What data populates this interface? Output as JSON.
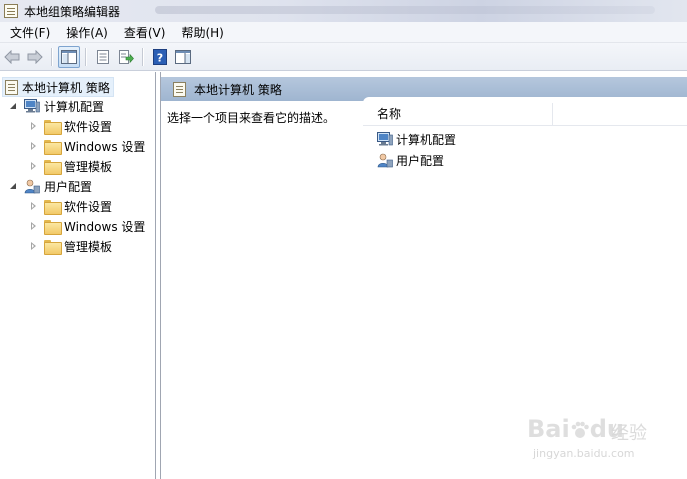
{
  "window": {
    "title": "本地组策略编辑器"
  },
  "menu": [
    {
      "label": "文件(F)"
    },
    {
      "label": "操作(A)"
    },
    {
      "label": "查看(V)"
    },
    {
      "label": "帮助(H)"
    }
  ],
  "toolbar": {
    "icons": [
      "back-arrow-icon",
      "forward-arrow-icon",
      "show-hide-tree-icon",
      "properties-icon",
      "export-list-icon",
      "help-icon",
      "show-action-pane-icon"
    ]
  },
  "tree": {
    "root": "本地计算机 策略",
    "computer_config": "计算机配置",
    "user_config": "用户配置",
    "computer_children": [
      "软件设置",
      "Windows 设置",
      "管理模板"
    ],
    "user_children": [
      "软件设置",
      "Windows 设置",
      "管理模板"
    ]
  },
  "right": {
    "header": "本地计算机 策略",
    "description": "选择一个项目来查看它的描述。",
    "column_name": "名称",
    "items": [
      "计算机配置",
      "用户配置"
    ]
  },
  "watermark": {
    "brand": "Bai",
    "brand_suffix": "du",
    "brand_cn": "经验",
    "url": "jingyan.baidu.com"
  }
}
